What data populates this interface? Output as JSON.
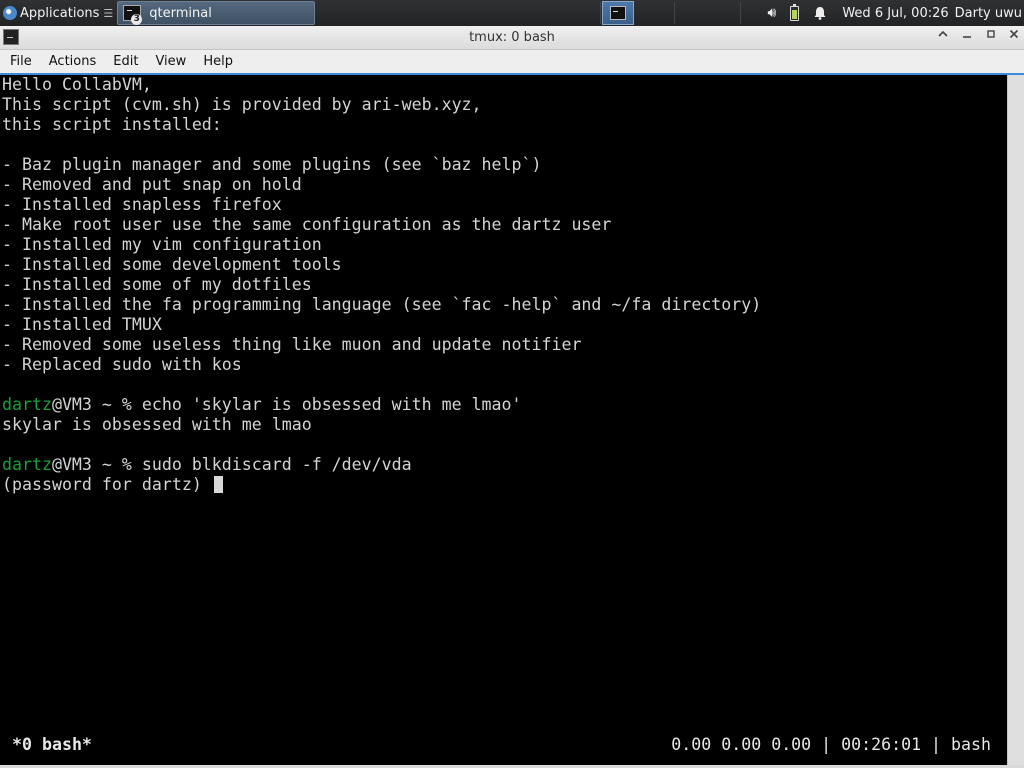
{
  "panel": {
    "applications_label": "Applications",
    "task": {
      "label": "qterminal",
      "badge": "3"
    },
    "clock": "Wed  6 Jul, 00:26",
    "user": "Darty uwu",
    "icons": {
      "apps": "menu-logo-icon",
      "volume": "volume-icon",
      "battery": "battery-icon",
      "notifications": "bell-icon",
      "desktop": "terminal-icon"
    }
  },
  "window": {
    "title": "tmux: 0 bash",
    "controls": {
      "shade": "^",
      "minimize": "_",
      "maximize": "□",
      "close": "×"
    }
  },
  "menubar": [
    "File",
    "Actions",
    "Edit",
    "View",
    "Help"
  ],
  "terminal": {
    "lines": [
      {
        "text": "Hello CollabVM,"
      },
      {
        "text": "This script (cvm.sh) is provided by ari-web.xyz,"
      },
      {
        "text": "this script installed:"
      },
      {
        "text": ""
      },
      {
        "text": "- Baz plugin manager and some plugins (see `baz help`)"
      },
      {
        "text": "- Removed and put snap on hold"
      },
      {
        "text": "- Installed snapless firefox"
      },
      {
        "text": "- Make root user use the same configuration as the dartz user"
      },
      {
        "text": "- Installed my vim configuration"
      },
      {
        "text": "- Installed some development tools"
      },
      {
        "text": "- Installed some of my dotfiles"
      },
      {
        "text": "- Installed the fa programming language (see `fac -help` and ~/fa directory)"
      },
      {
        "text": "- Installed TMUX"
      },
      {
        "text": "- Removed some useless thing like muon and update notifier"
      },
      {
        "text": "- Replaced sudo with kos"
      },
      {
        "text": ""
      },
      {
        "user": "dartz",
        "text": "@VM3 ~ % echo 'skylar is obsessed with me lmao'"
      },
      {
        "text": "skylar is obsessed with me lmao"
      },
      {
        "text": ""
      },
      {
        "user": "dartz",
        "text": "@VM3 ~ % sudo blkdiscard -f /dev/vda"
      },
      {
        "text": "(password for dartz) ",
        "cursor": true
      }
    ],
    "colors": {
      "fg": "#d4d4d4",
      "bg": "#000000",
      "prompt_user": "#18a03a"
    }
  },
  "status": {
    "window_label": "*0 bash*",
    "right": "0.00 0.00 0.00 | 00:26:01 | bash"
  }
}
